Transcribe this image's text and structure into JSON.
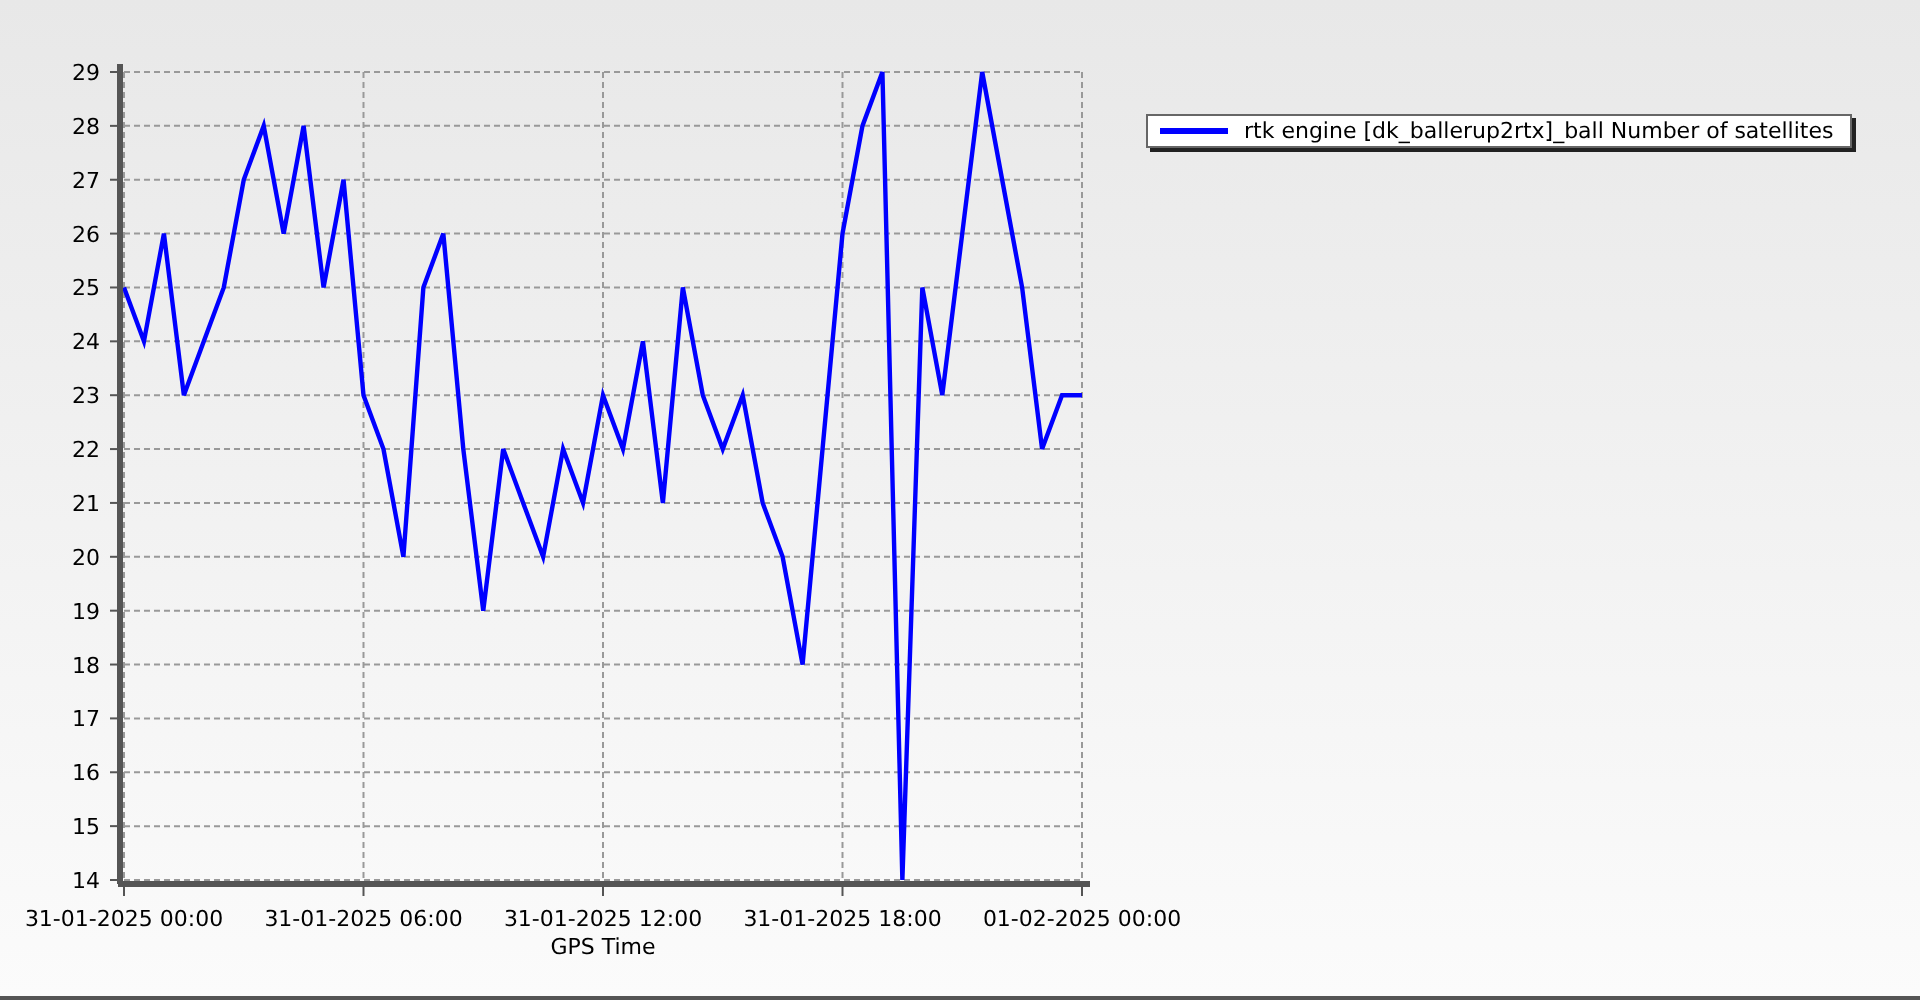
{
  "chart": {
    "chart_data": {
      "type": "line",
      "xlabel": "GPS Time",
      "categories": [
        "31-01-2025 00:00",
        null,
        null,
        null,
        null,
        null,
        null,
        null,
        null,
        null,
        null,
        null,
        "31-01-2025 06:00",
        null,
        null,
        null,
        null,
        null,
        null,
        null,
        null,
        null,
        null,
        null,
        "31-01-2025 12:00",
        null,
        null,
        null,
        null,
        null,
        null,
        null,
        null,
        null,
        null,
        null,
        "31-01-2025 18:00",
        null,
        null,
        null,
        null,
        null,
        null,
        null,
        null,
        null,
        null,
        null,
        "01-02-2025 00:00"
      ],
      "series": [
        {
          "name": "rtk engine [dk_ballerup2rtx]_ball Number of satellites",
          "color": "#0000ff",
          "values": [
            25,
            24,
            26,
            23,
            24,
            25,
            27,
            28,
            26,
            28,
            25,
            27,
            23,
            22,
            20,
            25,
            26,
            22,
            19,
            22,
            21,
            20,
            22,
            21,
            23,
            22,
            24,
            21,
            25,
            23,
            22,
            23,
            21,
            20,
            18,
            22,
            26,
            28,
            29,
            14,
            25,
            23,
            26,
            29,
            27,
            25,
            22,
            23,
            23
          ]
        }
      ],
      "grid": true,
      "ylim": [
        14,
        29
      ],
      "yticks": [
        14,
        15,
        16,
        17,
        18,
        19,
        20,
        21,
        22,
        23,
        24,
        25,
        26,
        27,
        28,
        29
      ]
    }
  }
}
